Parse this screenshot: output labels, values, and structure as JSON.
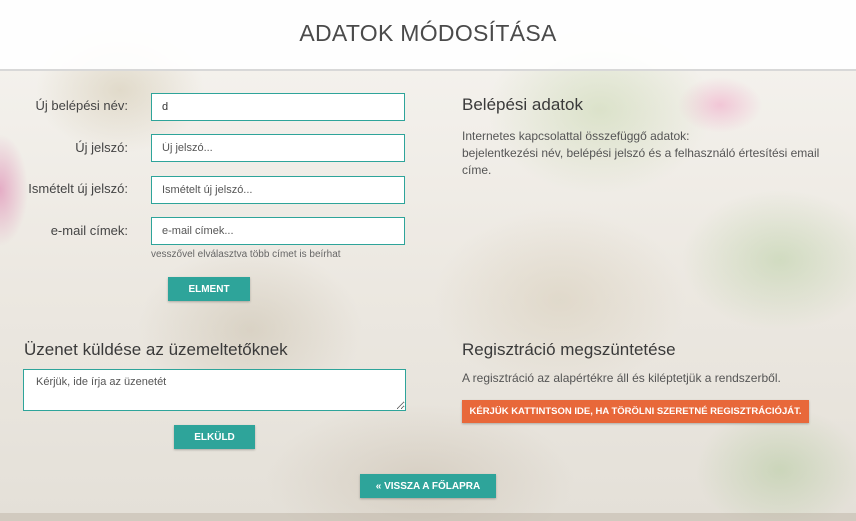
{
  "header": {
    "title": "ADATOK MÓDOSÍTÁSA"
  },
  "form": {
    "username": {
      "label": "Új belépési név:",
      "value": "d"
    },
    "password": {
      "label": "Új jelszó:",
      "placeholder": "Új jelszó..."
    },
    "password_repeat": {
      "label": "Ismételt új jelszó:",
      "placeholder": "Ismételt új jelszó..."
    },
    "email": {
      "label": "e-mail címek:",
      "placeholder": "e-mail címek...",
      "hint": "vesszővel elválasztva több címet is beírhat"
    },
    "submit_label": "ELMENT"
  },
  "login_info": {
    "heading": "Belépési adatok",
    "line1": "Internetes kapcsolattal összefüggő adatok:",
    "line2": "bejelentkezési név, belépési jelszó és a felhasználó értesítési email",
    "line3": "címe."
  },
  "message": {
    "heading": "Üzenet küldése az üzemeltetőknek",
    "placeholder": "Kérjük, ide írja az üzenetét",
    "send_label": "ELKÜLD"
  },
  "unregister": {
    "heading": "Regisztráció megszüntetése",
    "text": "A regisztráció az alapértékre áll és kiléptetjük a rendszerből.",
    "button_label": "KÉRJÜK KATTINTSON IDE, HA TÖRÖLNI SZERETNÉ REGISZTRÁCIÓJÁT."
  },
  "back_label": "« VISSZA A FŐLAPRA",
  "colors": {
    "accent": "#2ea49a",
    "danger": "#e8683a"
  }
}
